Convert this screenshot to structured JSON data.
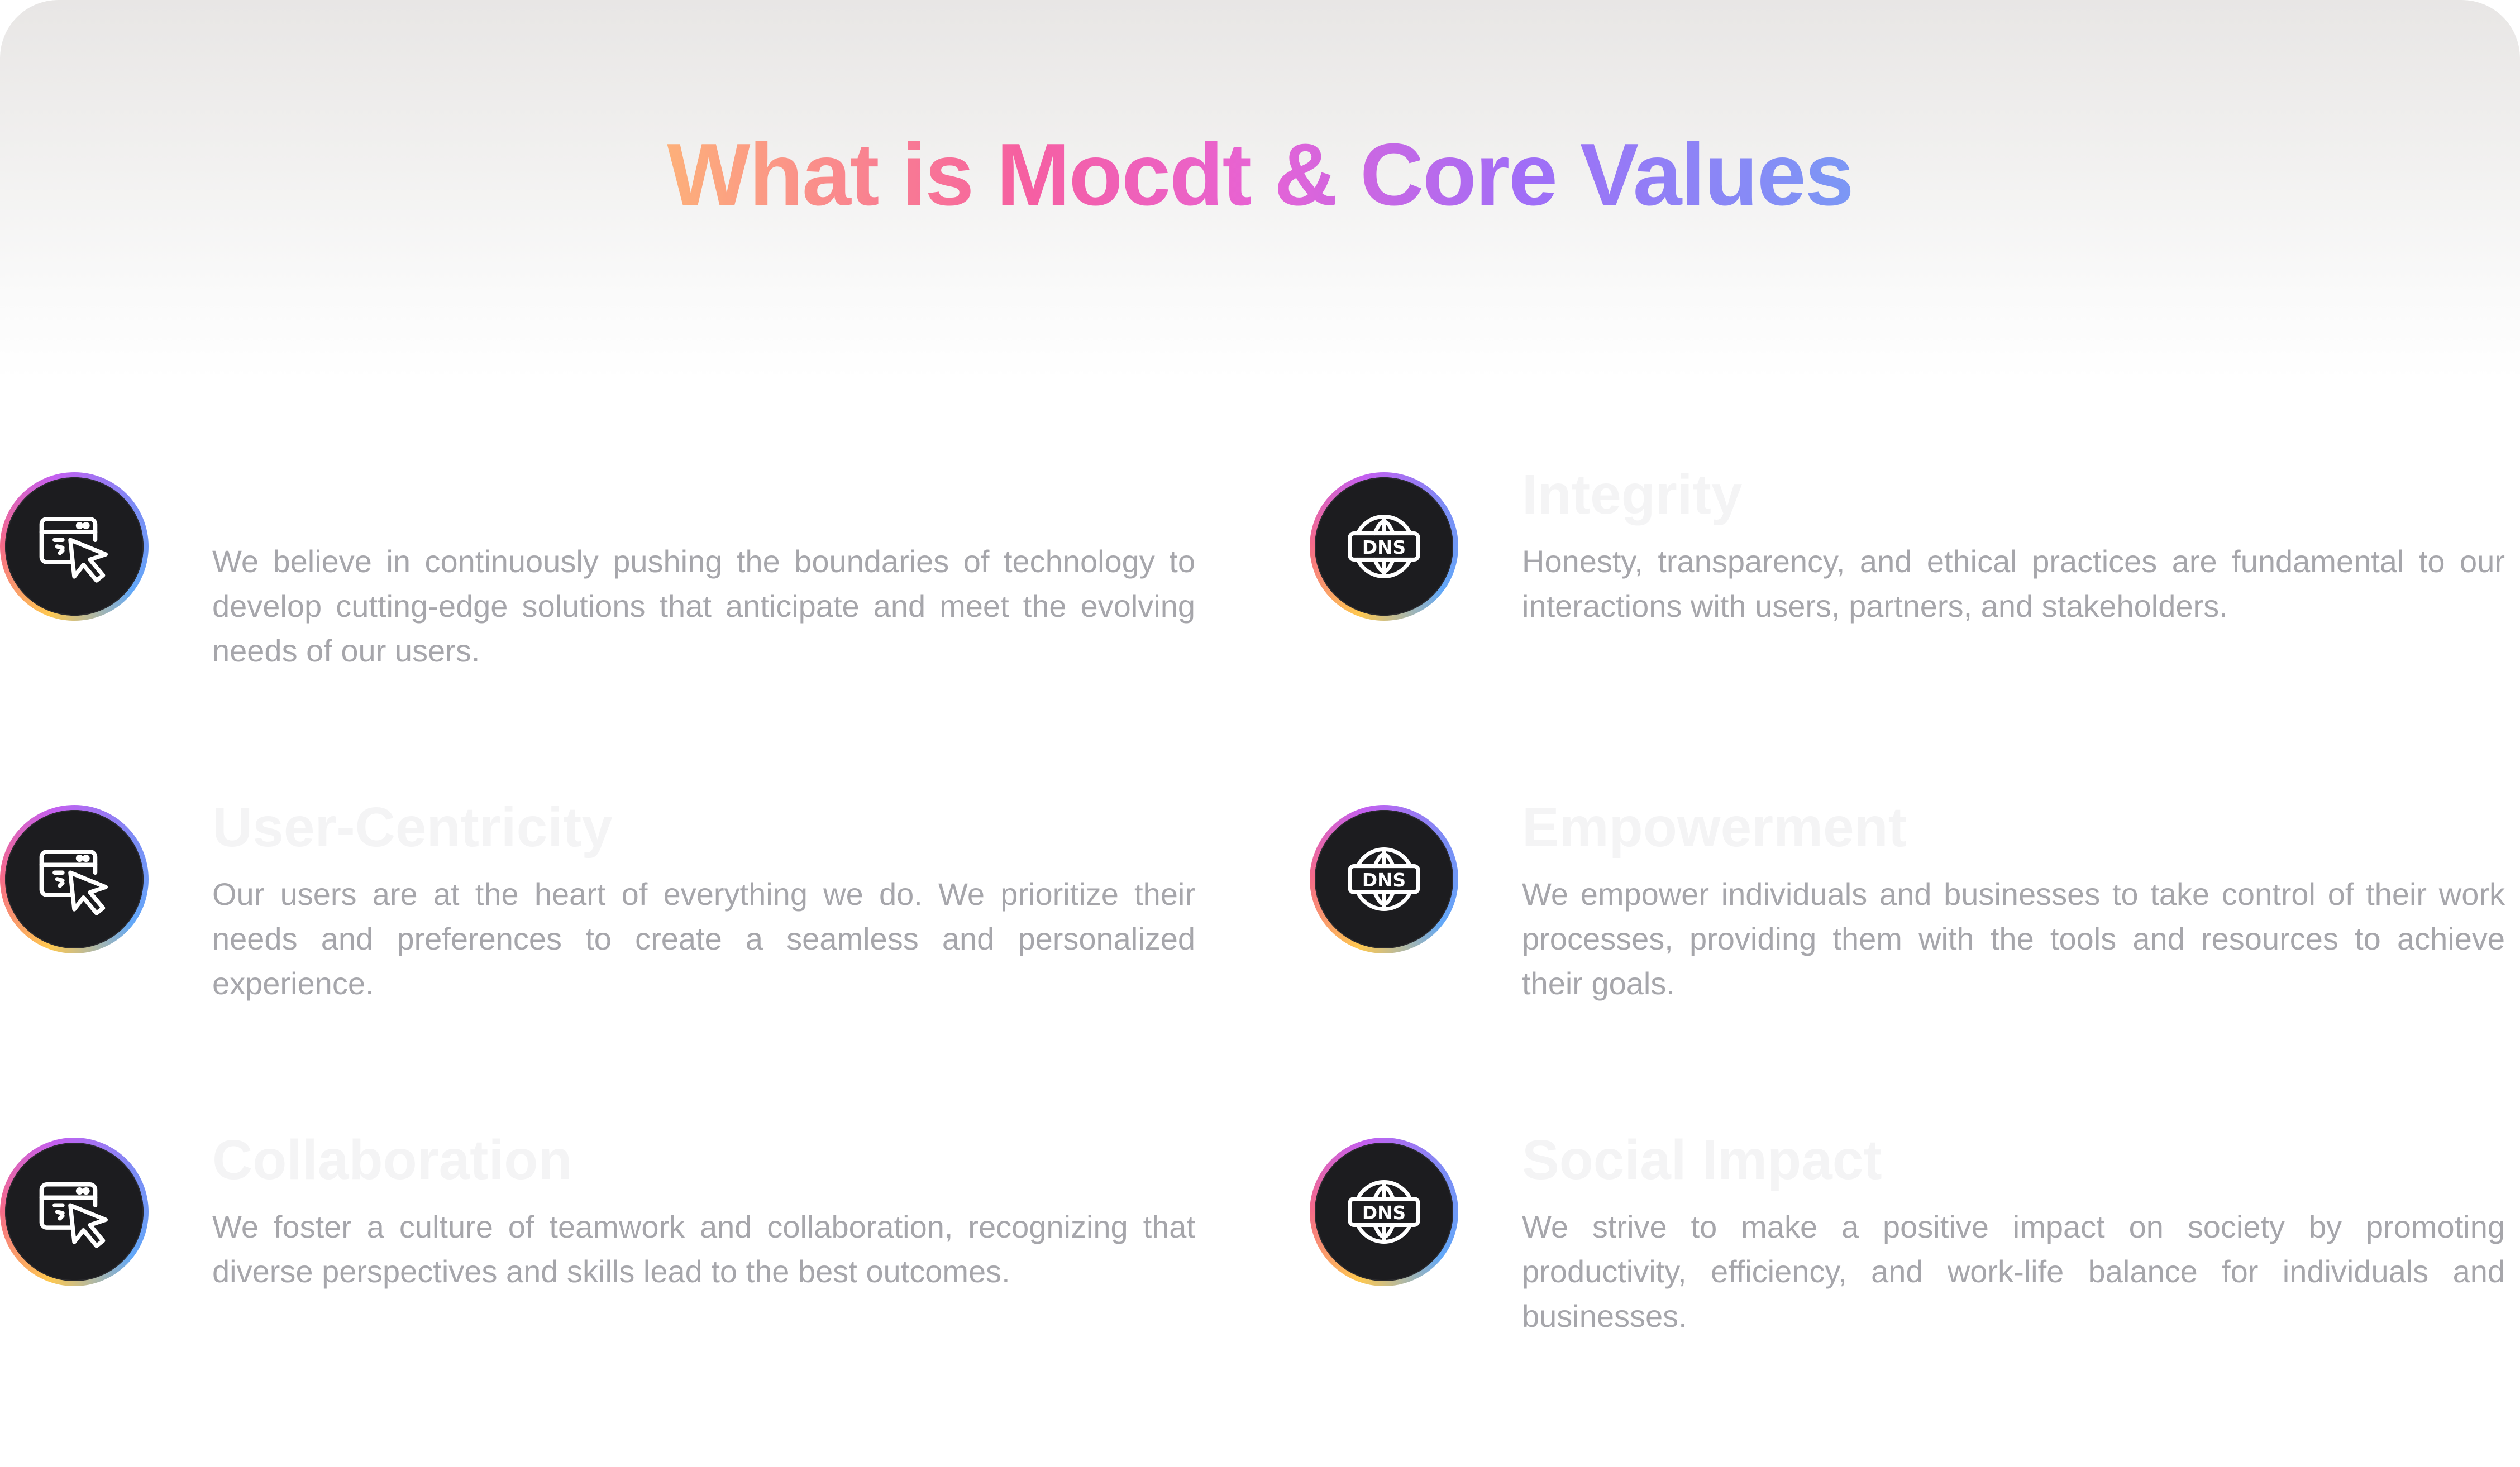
{
  "header": {
    "title": "What is Mocdt & Core Values"
  },
  "values": [
    {
      "title": "",
      "description": "We believe in continuously pushing the boundaries of technology to develop cutting-edge solutions that anticipate and meet the evolving needs of our users.",
      "icon": "browser-cursor-icon"
    },
    {
      "title": "Integrity",
      "description": "Honesty, transparency, and ethical practices are fundamental to our interactions with users, partners, and stakeholders.",
      "icon": "dns-globe-icon"
    },
    {
      "title": "User-Centricity",
      "description": "Our users are at the heart of everything we do. We prioritize their needs and preferences to create a seamless and personalized experience.",
      "icon": "browser-cursor-icon"
    },
    {
      "title": "Empowerment",
      "description": "We empower individuals and businesses to take control of their work processes, providing them with the tools and resources to achieve their goals.",
      "icon": "dns-globe-icon"
    },
    {
      "title": "Collaboration",
      "description": "We foster a culture of teamwork and collaboration, recognizing that diverse perspectives and skills lead to the best outcomes.",
      "icon": "browser-cursor-icon"
    },
    {
      "title": "Social Impact",
      "description": "We strive to make a positive impact on society by promoting productivity, efficiency, and work-life balance for individuals and businesses.",
      "icon": "dns-globe-icon"
    }
  ],
  "colors": {
    "title_gradient": [
      "#fdb07a",
      "#f65fa1",
      "#e763d5",
      "#a16df7",
      "#7b98f5"
    ],
    "icon_ring_gradient": [
      "#fec850",
      "#f56a8a",
      "#c45ff0",
      "#7c8cf5",
      "#62a8f8"
    ],
    "icon_background": "#1c1c1f",
    "description_text": "#a6a6ab",
    "heading_text": "#f4f4f5"
  }
}
